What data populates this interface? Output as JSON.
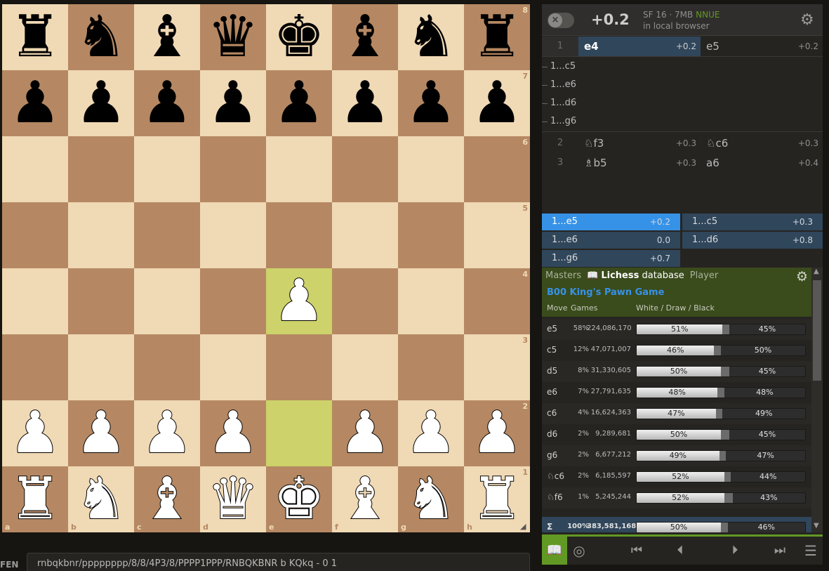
{
  "board": {
    "ranks": [
      {
        "rank": "8",
        "pieces": [
          "♜",
          "♞",
          "♝",
          "♛",
          "♚",
          "♝",
          "♞",
          "♜"
        ],
        "color": "b"
      },
      {
        "rank": "7",
        "pieces": [
          "♟",
          "♟",
          "♟",
          "♟",
          "♟",
          "♟",
          "♟",
          "♟"
        ],
        "color": "b"
      },
      {
        "rank": "6",
        "pieces": [
          "",
          "",
          "",
          "",
          "",
          "",
          "",
          ""
        ],
        "color": ""
      },
      {
        "rank": "5",
        "pieces": [
          "",
          "",
          "",
          "",
          "",
          "",
          "",
          ""
        ],
        "color": ""
      },
      {
        "rank": "4",
        "pieces": [
          "",
          "",
          "",
          "",
          "♟",
          "",
          "",
          ""
        ],
        "color": "w"
      },
      {
        "rank": "3",
        "pieces": [
          "",
          "",
          "",
          "",
          "",
          "",
          "",
          ""
        ],
        "color": ""
      },
      {
        "rank": "2",
        "pieces": [
          "♟",
          "♟",
          "♟",
          "♟",
          "",
          "♟",
          "♟",
          "♟"
        ],
        "color": "w"
      },
      {
        "rank": "1",
        "pieces": [
          "♜",
          "♞",
          "♝",
          "♛",
          "♚",
          "♝",
          "♞",
          "♜"
        ],
        "color": "w"
      }
    ],
    "files": [
      "a",
      "b",
      "c",
      "d",
      "e",
      "f",
      "g",
      "h"
    ],
    "highlighted": [
      "e4",
      "e2"
    ],
    "light_color": "#f0d9b5",
    "dark_color": "#b58863",
    "highlight_color": "#cdd26a"
  },
  "fen": {
    "label": "FEN",
    "value": "rnbqkbnr/pppppppp/8/8/4P3/8/PPPP1PPP/RNBQKBNR b KQkq - 0 1"
  },
  "ceval": {
    "toggle_icon": "×",
    "score": "+0.2",
    "engine": "SF 16 · 7MB",
    "nnue": "NNUE",
    "location": "in local browser",
    "settings_icon": "⚙"
  },
  "moves": {
    "row1": {
      "num": "1",
      "white": "e4",
      "white_eval": "+0.2",
      "black": "e5",
      "black_eval": "+0.2"
    },
    "variations": [
      "1...c5",
      "1...e6",
      "1...d6",
      "1...g6"
    ],
    "row2": {
      "num": "2",
      "white": "♘f3",
      "white_eval": "+0.3",
      "black": "♘c6",
      "black_eval": "+0.3"
    },
    "row3": {
      "num": "3",
      "white": "♗b5",
      "white_eval": "+0.3",
      "black": "a6",
      "black_eval": "+0.4"
    }
  },
  "pvs": [
    {
      "move": "1...e5",
      "eval": "+0.2"
    },
    {
      "move": "1...c5",
      "eval": "+0.3"
    },
    {
      "move": "1...e6",
      "eval": "0.0"
    },
    {
      "move": "1...d6",
      "eval": "+0.8"
    },
    {
      "move": "1...g6",
      "eval": "+0.7"
    }
  ],
  "explorer": {
    "tabs": {
      "masters": "Masters",
      "lichess_bold": "Lichess",
      "lichess_rest": " database",
      "player": "Player"
    },
    "book_icon": "📖",
    "gear_icon": "⚙",
    "opening": "B00 King's Pawn Game",
    "col_move": "Move",
    "col_games": "Games",
    "col_wdb": "White / Draw / Black",
    "rows": [
      {
        "move": "e5",
        "pct": "58%",
        "games": "224,086,170",
        "white": 51,
        "black": 45,
        "white_label": "51%",
        "black_label": "45%"
      },
      {
        "move": "c5",
        "pct": "12%",
        "games": "47,071,007",
        "white": 46,
        "black": 50,
        "white_label": "46%",
        "black_label": "50%"
      },
      {
        "move": "d5",
        "pct": "8%",
        "games": "31,330,605",
        "white": 50,
        "black": 45,
        "white_label": "50%",
        "black_label": "45%"
      },
      {
        "move": "e6",
        "pct": "7%",
        "games": "27,791,635",
        "white": 48,
        "black": 48,
        "white_label": "48%",
        "black_label": "48%"
      },
      {
        "move": "c6",
        "pct": "4%",
        "games": "16,624,363",
        "white": 47,
        "black": 49,
        "white_label": "47%",
        "black_label": "49%"
      },
      {
        "move": "d6",
        "pct": "2%",
        "games": "9,289,681",
        "white": 50,
        "black": 45,
        "white_label": "50%",
        "black_label": "45%"
      },
      {
        "move": "g6",
        "pct": "2%",
        "games": "6,677,212",
        "white": 49,
        "black": 47,
        "white_label": "49%",
        "black_label": "47%"
      },
      {
        "move": "♘c6",
        "pct": "2%",
        "games": "6,185,597",
        "white": 52,
        "black": 44,
        "white_label": "52%",
        "black_label": "44%"
      },
      {
        "move": "♘f6",
        "pct": "1%",
        "games": "5,245,244",
        "white": 52,
        "black": 43,
        "white_label": "52%",
        "black_label": "43%"
      }
    ],
    "total": {
      "move": "Σ",
      "pct": "100%",
      "games": "383,581,168",
      "white": 50,
      "black": 46,
      "white_label": "50%",
      "black_label": "46%"
    }
  },
  "controls": {
    "book": "📖",
    "target": "◎",
    "first": "⏮",
    "prev": "⏴",
    "next": "⏵",
    "last": "⏭",
    "menu": "☰"
  }
}
